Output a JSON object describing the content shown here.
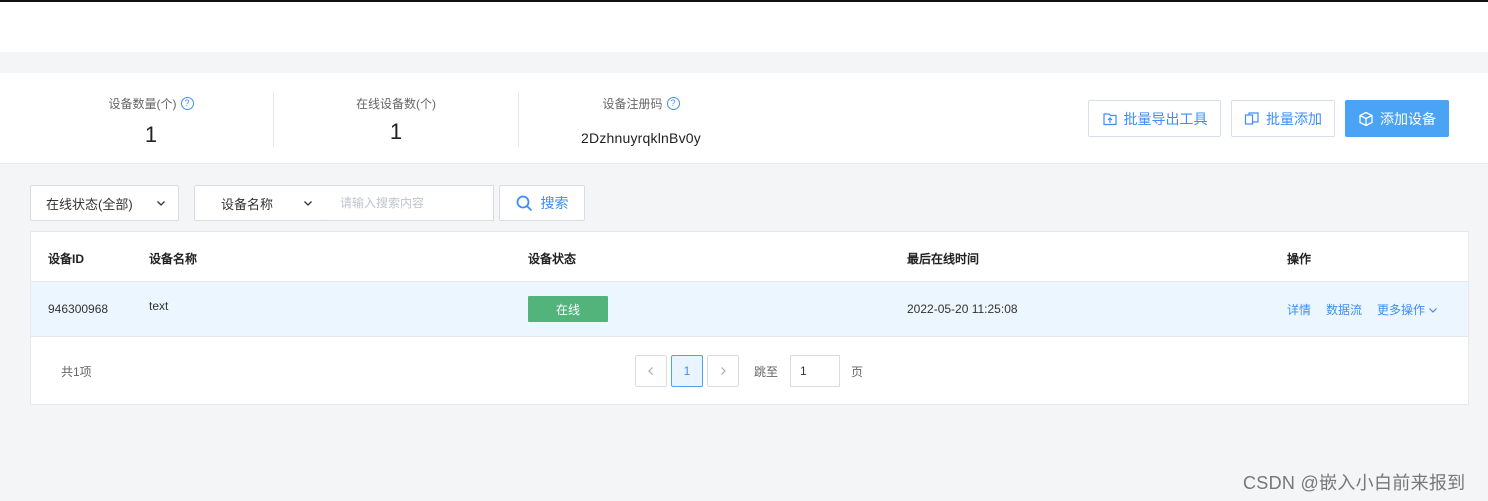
{
  "stats": {
    "device_count_label": "设备数量(个)",
    "device_count_value": "1",
    "online_count_label": "在线设备数(个)",
    "online_count_value": "1",
    "reg_code_label": "设备注册码",
    "reg_code_value": "2DzhnuyrqklnBv0y"
  },
  "actions": {
    "export_tool": "批量导出工具",
    "batch_add": "批量添加",
    "add_device": "添加设备"
  },
  "filters": {
    "status_select": "在线状态(全部)",
    "field_select": "设备名称",
    "search_placeholder": "请输入搜索内容",
    "search_button": "搜索"
  },
  "table": {
    "headers": [
      "设备ID",
      "设备名称",
      "设备状态",
      "最后在线时间",
      "操作"
    ],
    "rows": [
      {
        "id": "946300968",
        "name": "text",
        "status": "在线",
        "last_online": "2022-05-20 11:25:08",
        "op_detail": "详情",
        "op_dataflow": "数据流",
        "op_more": "更多操作"
      }
    ]
  },
  "pagination": {
    "total": "共1项",
    "current_page": "1",
    "jump_label": "跳至",
    "jump_value": "1",
    "page_unit": "页"
  },
  "watermark": "CSDN @嵌入小白前来报到",
  "colors": {
    "accent": "#3d8ef7",
    "primary_button": "#4aa3f5",
    "online_badge": "#52b47b",
    "row_highlight": "#ecf6fe"
  }
}
